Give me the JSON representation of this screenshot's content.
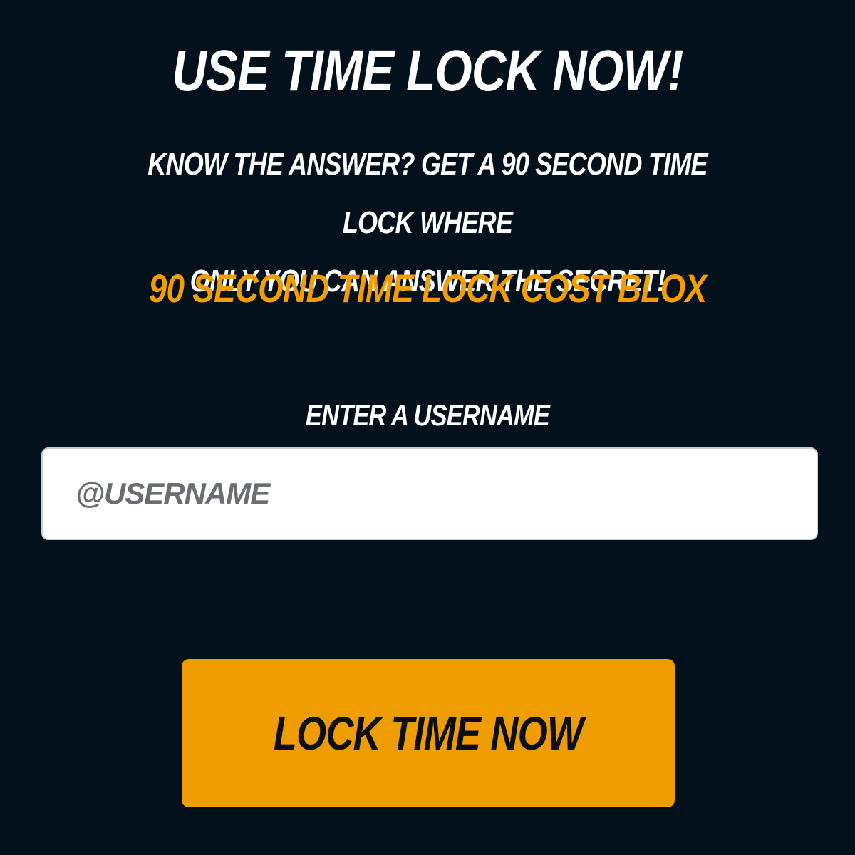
{
  "heading": "USE TIME LOCK NOW!",
  "description": {
    "line1": "KNOW THE ANSWER? GET A 90 SECOND TIME LOCK WHERE",
    "line2": "ONLY YOU CAN ANSWER THE SECRET!"
  },
  "cost_text": "90 SECOND TIME LOCK COST BLOX",
  "username_field": {
    "label": "ENTER A USERNAME",
    "placeholder": "@USERNAME",
    "value": ""
  },
  "submit_button": {
    "label": "LOCK TIME NOW"
  },
  "colors": {
    "background": "#02111b",
    "accent": "#f29d00",
    "text": "#ffffff",
    "button_text": "#0b0f14"
  }
}
